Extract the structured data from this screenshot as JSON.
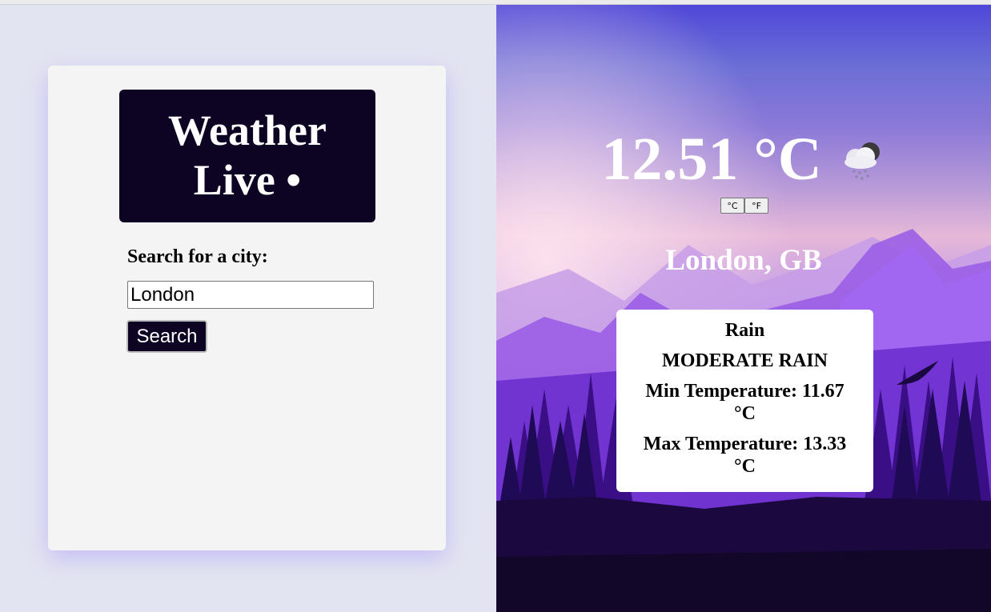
{
  "app": {
    "title_line1": "Weather",
    "title_line2": "Live •"
  },
  "search": {
    "label": "Search for a city:",
    "value": "London",
    "button_label": "Search"
  },
  "weather": {
    "temperature": "12.51 °C",
    "icon": "rain-cloud-icon",
    "unit_celsius": "°C",
    "unit_fahrenheit": "°F",
    "location": "London, GB",
    "main": "Rain",
    "description": "MODERATE RAIN",
    "min_temp": "Min Temperature: 11.67 °C",
    "max_temp": "Max Temperature: 13.33 °C"
  },
  "colors": {
    "brand_dark": "#0d0423",
    "left_bg": "#e3e4f1",
    "card_bg": "#f4f4f4",
    "sky_top": "#4f47d8",
    "mountain_purple": "#7c3fd6"
  }
}
